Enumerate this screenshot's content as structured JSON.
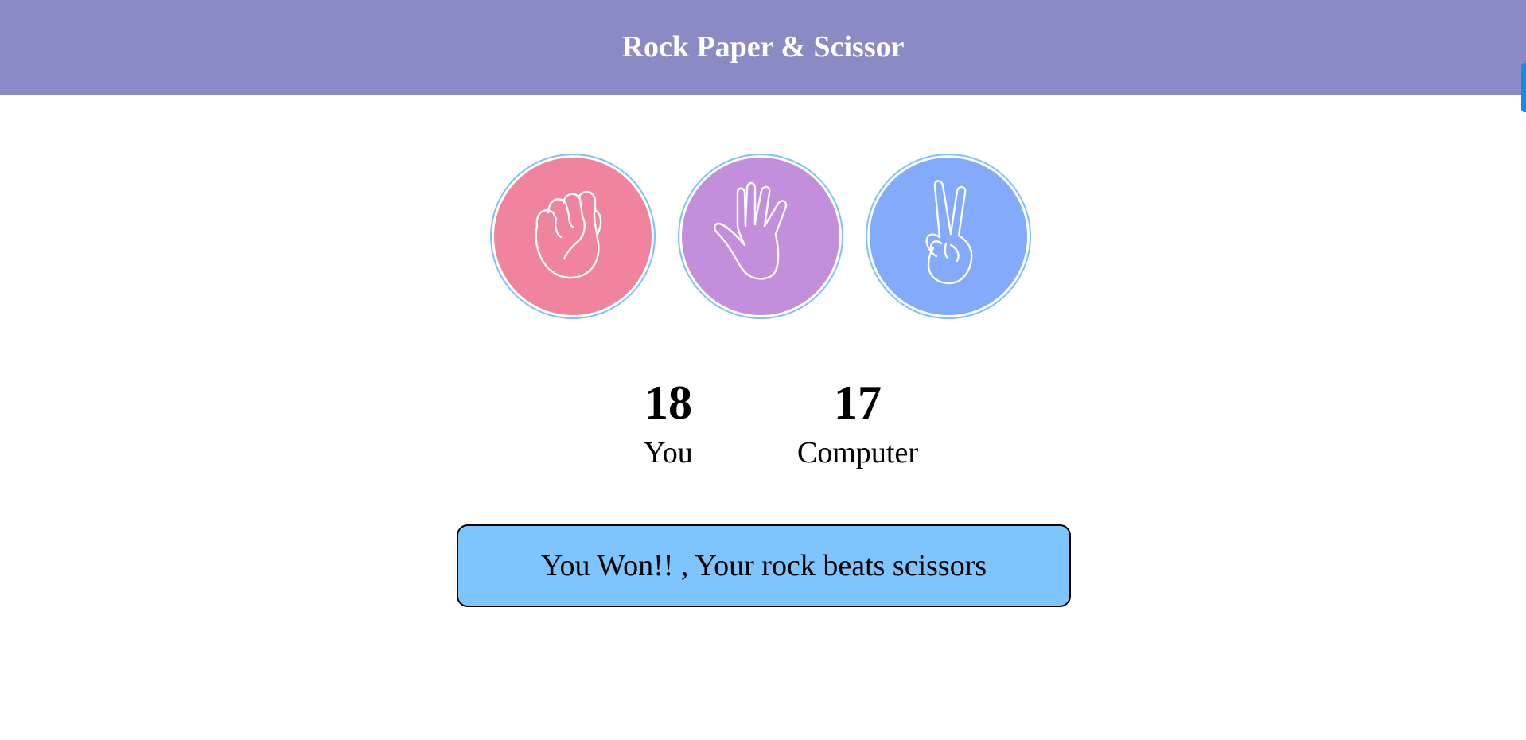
{
  "header": {
    "title": "Rock Paper & Scissor"
  },
  "choices": [
    {
      "name": "rock",
      "icon": "rock-hand-icon",
      "color": "#f0849f"
    },
    {
      "name": "paper",
      "icon": "paper-hand-icon",
      "color": "#c38fdc"
    },
    {
      "name": "scissors",
      "icon": "scissors-hand-icon",
      "color": "#84aafc"
    }
  ],
  "scores": {
    "user": {
      "value": "18",
      "label": "You"
    },
    "computer": {
      "value": "17",
      "label": "Computer"
    }
  },
  "message": "You Won!! , Your rock beats scissors",
  "colors": {
    "header_bg": "#8a8ac4",
    "ring": "#7dc3fb",
    "message_bg": "#7ec4fd",
    "scroll_tab": "#1e88e5"
  }
}
